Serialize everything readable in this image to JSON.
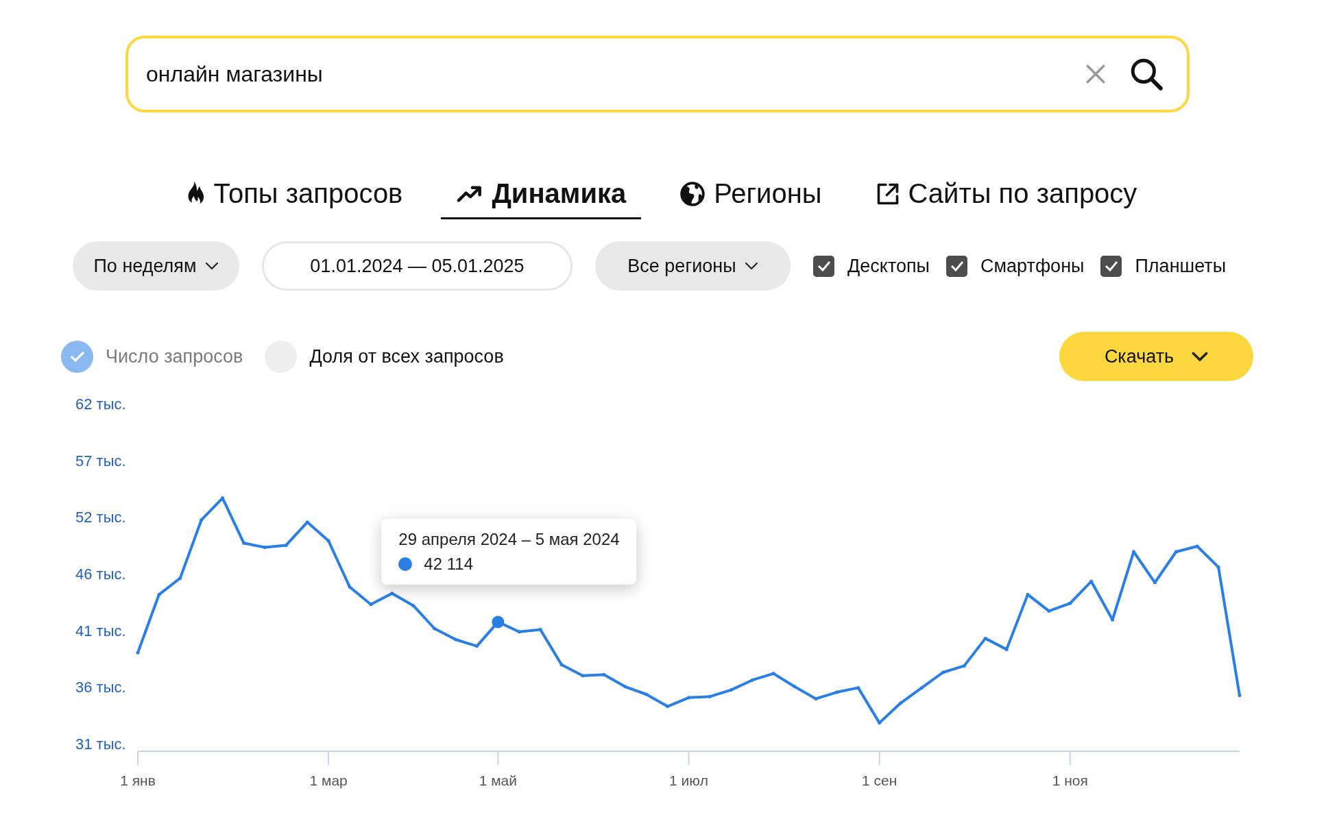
{
  "search": {
    "value": "онлайн магазины"
  },
  "tabs": [
    {
      "label": "Топы запросов",
      "kind": "top",
      "selected": false
    },
    {
      "label": "Динамика",
      "kind": "dynamics",
      "selected": true
    },
    {
      "label": "Регионы",
      "kind": "regions",
      "selected": false
    },
    {
      "label": "Сайты по запросу",
      "kind": "sites",
      "selected": false
    }
  ],
  "filters": {
    "period": {
      "label": "По неделям"
    },
    "date_range": {
      "value": "01.01.2024 — 05.01.2025"
    },
    "region": {
      "label": "Все регионы"
    },
    "devices": [
      {
        "label": "Десктопы",
        "checked": true
      },
      {
        "label": "Смартфоны",
        "checked": true
      },
      {
        "label": "Планшеты",
        "checked": true
      }
    ]
  },
  "legend": [
    {
      "label": "Число запросов",
      "selected": true
    },
    {
      "label": "Доля от всех запросов",
      "selected": false
    }
  ],
  "download_button": {
    "label": "Скачать"
  },
  "chart": {
    "tooltip": {
      "title": "29 апреля 2024 – 5 мая 2024"
    },
    "chart_data": {
      "type": "line",
      "categories": [
        "1 янв",
        null,
        null,
        null,
        null,
        null,
        null,
        null,
        null,
        "1 мар",
        null,
        null,
        null,
        null,
        null,
        null,
        null,
        "1 май",
        null,
        null,
        null,
        null,
        null,
        null,
        null,
        null,
        "1 июл",
        null,
        null,
        null,
        null,
        null,
        null,
        null,
        null,
        "1 сен",
        null,
        null,
        null,
        null,
        null,
        null,
        null,
        null,
        "1 ноя",
        null,
        null,
        null,
        null,
        null,
        null,
        null,
        null
      ],
      "series": [
        {
          "color": "#2a7fe6",
          "values": [
            39.3,
            44.6,
            46.1,
            51.4,
            53.4,
            49.3,
            48.9,
            49.1,
            51.2,
            49.5,
            45.3,
            43.7,
            44.7,
            43.6,
            41.5,
            40.5,
            39.9,
            42.1,
            41.2,
            41.4,
            38.2,
            37.2,
            37.3,
            36.2,
            35.5,
            34.4,
            35.2,
            35.3,
            35.9,
            36.8,
            37.4,
            36.2,
            35.1,
            35.7,
            36.1,
            32.9,
            34.7,
            36.1,
            37.5,
            38.1,
            40.6,
            39.6,
            44.6,
            43.1,
            43.8,
            45.8,
            42.3,
            48.5,
            45.7,
            48.5,
            49.0,
            47.1,
            35.4
          ]
        }
      ],
      "ylim": [
        31,
        62
      ],
      "yticks": [
        {
          "value": 62,
          "label": "62 тыс."
        },
        {
          "value": 56.83,
          "label": "57 тыс."
        },
        {
          "value": 51.67,
          "label": "52 тыс."
        },
        {
          "value": 46.5,
          "label": "46 тыс."
        },
        {
          "value": 41.33,
          "label": "41 тыс."
        },
        {
          "value": 36.17,
          "label": "36 тыс."
        },
        {
          "value": 31,
          "label": "31 тыс."
        }
      ],
      "annotations": [
        "42 114"
      ]
    },
    "hovered": [
      false,
      false,
      false,
      false,
      false,
      false,
      false,
      false,
      false,
      false,
      false,
      false,
      false,
      false,
      false,
      false,
      false,
      true,
      false,
      false,
      false,
      false,
      false,
      false,
      false,
      false,
      false,
      false,
      false,
      false,
      false,
      false,
      false,
      false,
      false,
      false,
      false,
      false,
      false,
      false,
      false,
      false,
      false,
      false,
      false,
      false,
      false,
      false,
      false,
      false,
      false,
      false,
      false
    ]
  }
}
